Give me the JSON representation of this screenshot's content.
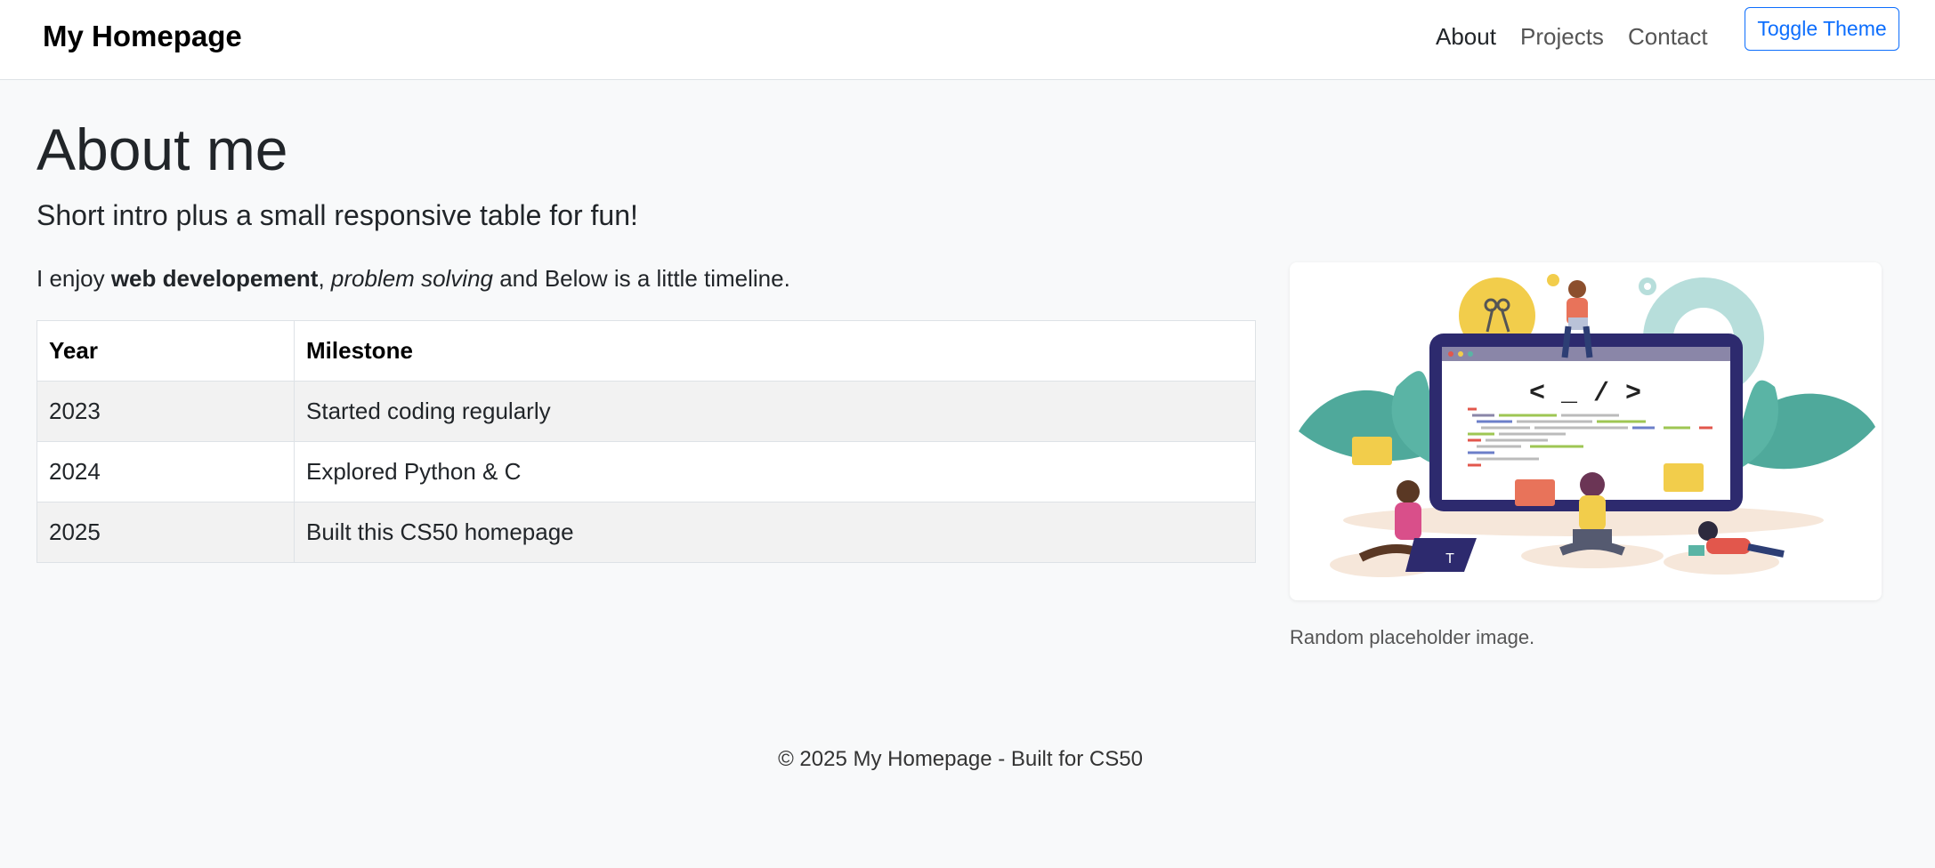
{
  "nav": {
    "brand": "My Homepage",
    "links": [
      "About",
      "Projects",
      "Contact"
    ],
    "toggle_label": "Toggle Theme"
  },
  "main": {
    "title": "About me",
    "lead": "Short intro plus a small responsive table for fun!",
    "intro": {
      "prefix": "I enjoy ",
      "bold": "web developement",
      "sep": ", ",
      "italic": "problem solving",
      "suffix": " and Below is a little timeline."
    },
    "table": {
      "headers": [
        "Year",
        "Milestone"
      ],
      "rows": [
        [
          "2023",
          "Started coding regularly"
        ],
        [
          "2024",
          "Explored Python & C"
        ],
        [
          "2025",
          "Built this CS50 homepage"
        ]
      ]
    },
    "image": {
      "code_text": "< _ / >",
      "caption": "Random placeholder image."
    }
  },
  "footer": {
    "text": "© 2025 My Homepage - Built for CS50"
  },
  "colors": {
    "accent": "#0d6efd",
    "background": "#f8f9fa",
    "illustration_leaf": "#4fa99b",
    "illustration_screen": "#2d2a6e"
  }
}
